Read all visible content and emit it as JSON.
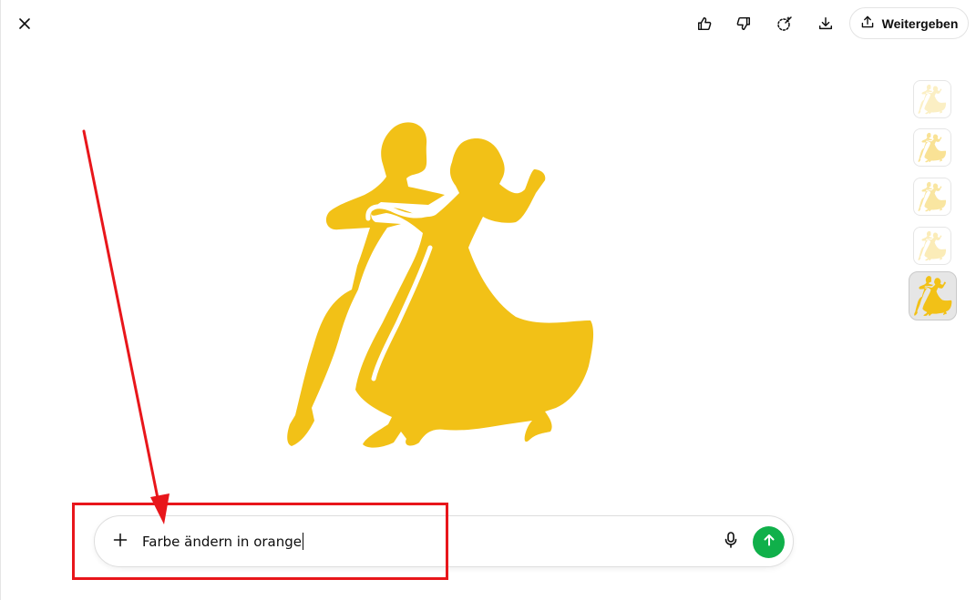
{
  "toolbar": {
    "close_icon": "close-icon",
    "like_icon": "thumbs-up-icon",
    "dislike_icon": "thumbs-down-icon",
    "select_icon": "magic-select-icon",
    "download_icon": "download-icon",
    "share_icon": "share-upload-icon",
    "share_label": "Weitergeben"
  },
  "image": {
    "subject_icon": "ballroom-dancers-silhouette",
    "color": "#f2c117"
  },
  "thumbnails": [
    {
      "opacity": 0.25,
      "selected": false
    },
    {
      "opacity": 0.45,
      "selected": false
    },
    {
      "opacity": 0.4,
      "selected": false
    },
    {
      "opacity": 0.3,
      "selected": false
    },
    {
      "opacity": 1.0,
      "selected": true
    }
  ],
  "composer": {
    "text": "Farbe ändern in orange",
    "add_icon": "plus-icon",
    "mic_icon": "microphone-icon",
    "send_icon": "arrow-up-icon",
    "send_color": "#10b04a"
  },
  "annotation": {
    "color": "#e8161b"
  }
}
